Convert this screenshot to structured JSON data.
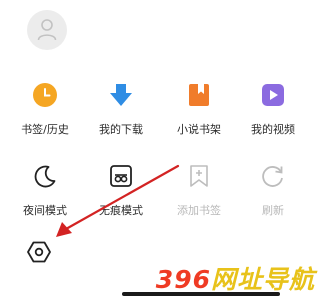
{
  "profile": {
    "avatar_icon": "user-icon"
  },
  "row1": [
    {
      "id": "bookmarks-history",
      "label": "书签/历史",
      "icon": "clock-icon",
      "color": "#f5a623"
    },
    {
      "id": "downloads",
      "label": "我的下载",
      "icon": "download-arrow-icon",
      "color": "#2f8de4"
    },
    {
      "id": "novel-shelf",
      "label": "小说书架",
      "icon": "bookmark-book-icon",
      "color": "#f07c2b"
    },
    {
      "id": "videos",
      "label": "我的视频",
      "icon": "play-icon",
      "color": "#8b6be0"
    }
  ],
  "row2": [
    {
      "id": "night-mode",
      "label": "夜间模式",
      "icon": "moon-icon",
      "enabled": true
    },
    {
      "id": "incognito-mode",
      "label": "无痕模式",
      "icon": "incognito-mask-icon",
      "enabled": true
    },
    {
      "id": "add-bookmark",
      "label": "添加书签",
      "icon": "bookmark-plus-icon",
      "enabled": false
    },
    {
      "id": "refresh",
      "label": "刷新",
      "icon": "refresh-icon",
      "enabled": false
    }
  ],
  "settings": {
    "icon": "hexagon-gear-icon"
  },
  "annotation": {
    "color": "#d32323"
  },
  "watermark": {
    "part1": "396",
    "part2": "网址导航"
  }
}
